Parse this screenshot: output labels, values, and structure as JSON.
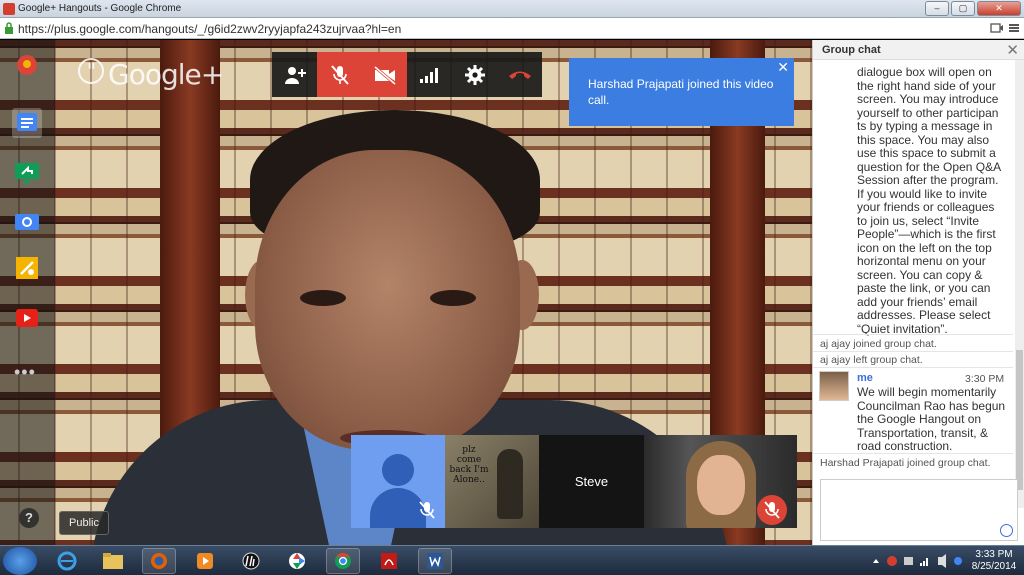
{
  "window": {
    "title": "Google+ Hangouts - Google Chrome",
    "url": "https://plus.google.com/hangouts/_/g6id2zwv2ryyjapfa243zujrvaa?hl=en"
  },
  "app": {
    "logo_text": "Google+",
    "public_label": "Public"
  },
  "left_bar": {
    "items": [
      {
        "icon": "hangouts-badge-icon"
      },
      {
        "icon": "chat-icon"
      },
      {
        "icon": "screenshare-icon"
      },
      {
        "icon": "camera-icon"
      },
      {
        "icon": "effects-icon"
      },
      {
        "icon": "youtube-icon"
      },
      {
        "icon": "more-icon"
      }
    ],
    "more_label": "•••",
    "help_label": "?"
  },
  "toolbar": {
    "buttons": [
      "invite-people-icon",
      "mic-muted-icon",
      "camera-off-icon",
      "bandwidth-icon",
      "settings-icon",
      "end-call-icon"
    ]
  },
  "notification": {
    "text": "Harshad Prajapati joined this video call.",
    "close": "✕"
  },
  "filmstrip": {
    "thumb2_text": "plz come back I'm Alone..",
    "steve_name": "Steve"
  },
  "chat": {
    "title": "Group chat",
    "close": "✕",
    "message_intro": "dialogue box will open on the right hand side of your screen. You may introduce yourself to other participan ts by typing a message in this space. You may also use this space to submit a question for the Open Q&A Session after the program. If you would like to invite your friends or colleagues to join us, select “Invite People”—which is the first icon on the left on the top horizontal menu on your screen. You can copy & paste the link, or you can add your friends’ email addresses. Please select “Quiet invitation”.",
    "sys1": "aj ajay joined group chat.",
    "sys2": "aj ajay left group chat.",
    "me_name": "me",
    "me_time": "3:30 PM",
    "me_message": "We will begin momentarily Councilman Rao has begun the Google Hangout on Transportation, transit, & road construction.",
    "sys3": "Harshad Prajapati joined group chat."
  },
  "taskbar": {
    "time": "3:33 PM",
    "date": "8/25/2014"
  },
  "colors": {
    "accent_blue": "#3b7de0",
    "danger_red": "#db4437"
  }
}
